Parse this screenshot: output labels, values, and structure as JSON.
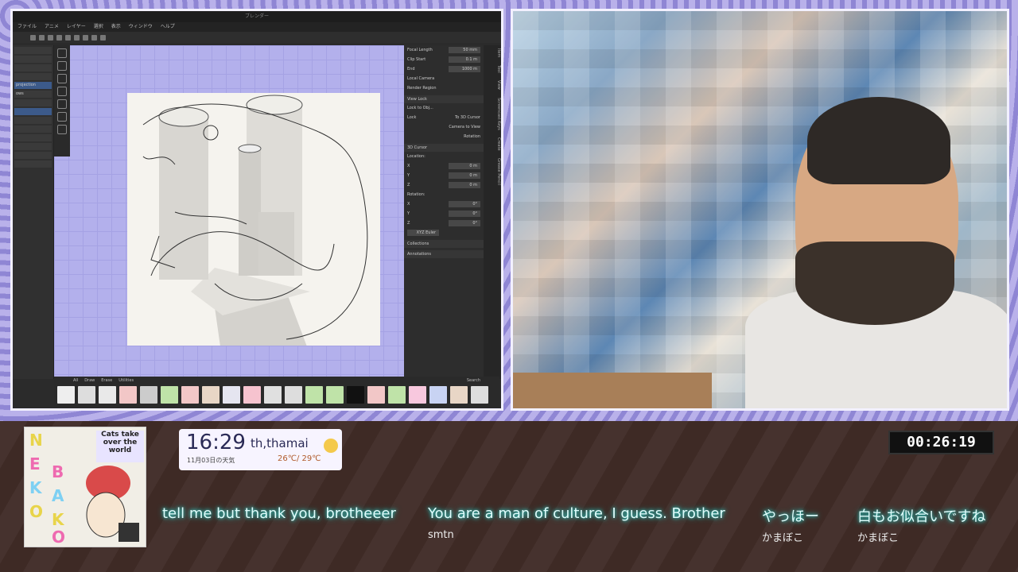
{
  "blender": {
    "title": "ブレンダー",
    "menu": [
      "ファイル",
      "アニメ",
      "レイヤー",
      "選択",
      "表示",
      "ウィンドウ",
      "ヘルプ"
    ],
    "outliner": [
      "projection",
      "ows"
    ],
    "props": {
      "focal_length_label": "Focal Length",
      "focal_length": "50 mm",
      "clip_start_label": "Clip Start",
      "clip_start": "0.1 m",
      "clip_end_label": "End",
      "clip_end": "1000 m",
      "local_camera_label": "Local Camera",
      "render_region_label": "Render Region",
      "view_lock_label": "View Lock",
      "lock_object_label": "Lock to Obj...",
      "lock_label": "Lock",
      "to_3d_cursor_label": "To 3D Cursor",
      "camera_to_view_label": "Camera to View",
      "rotation_label": "Rotation",
      "cursor_header": "3D Cursor",
      "location_label": "Location:",
      "rotation_header": "Rotation:",
      "euler_label": "XYZ Euler",
      "collections_label": "Collections",
      "annotations_label": "Annotations",
      "x_loc": "0 m",
      "y_loc": "0 m",
      "z_loc": "0 m",
      "x_rot": "0°",
      "y_rot": "0°",
      "z_rot": "0°"
    },
    "side_tabs": [
      "Item",
      "Tool",
      "View",
      "Screencast Keys",
      "Create",
      "Grease Pencil"
    ],
    "brush_tabs": [
      "All",
      "Draw",
      "Erase",
      "Utilities"
    ],
    "brush_search_placeholder": "Search"
  },
  "overlay": {
    "poster_title": "Cats take over the world",
    "poster_letters": [
      "N",
      "E",
      "K",
      "O",
      "B",
      "A",
      "K",
      "O"
    ],
    "clock_time": "16:29",
    "clock_user": "th,thamai",
    "clock_date": "11月03日の天気",
    "clock_temp": "26℃/ 29℃",
    "timer": "00:26:19"
  },
  "chat": [
    {
      "text": "tell me but thank you, brotheeer",
      "name": ""
    },
    {
      "text": "You are a man of culture, I guess. Brother",
      "name": "smtn"
    },
    {
      "text": "やっほー",
      "name": "かまぼこ"
    },
    {
      "text": "白もお似合いですね",
      "name": "かまぼこ"
    }
  ],
  "colors": {
    "frame_bg": "#b7b2dc",
    "viewport": "#b3b0ec",
    "chat_glow": "#35d7d0",
    "bottom_bg": "#3e2a25"
  }
}
